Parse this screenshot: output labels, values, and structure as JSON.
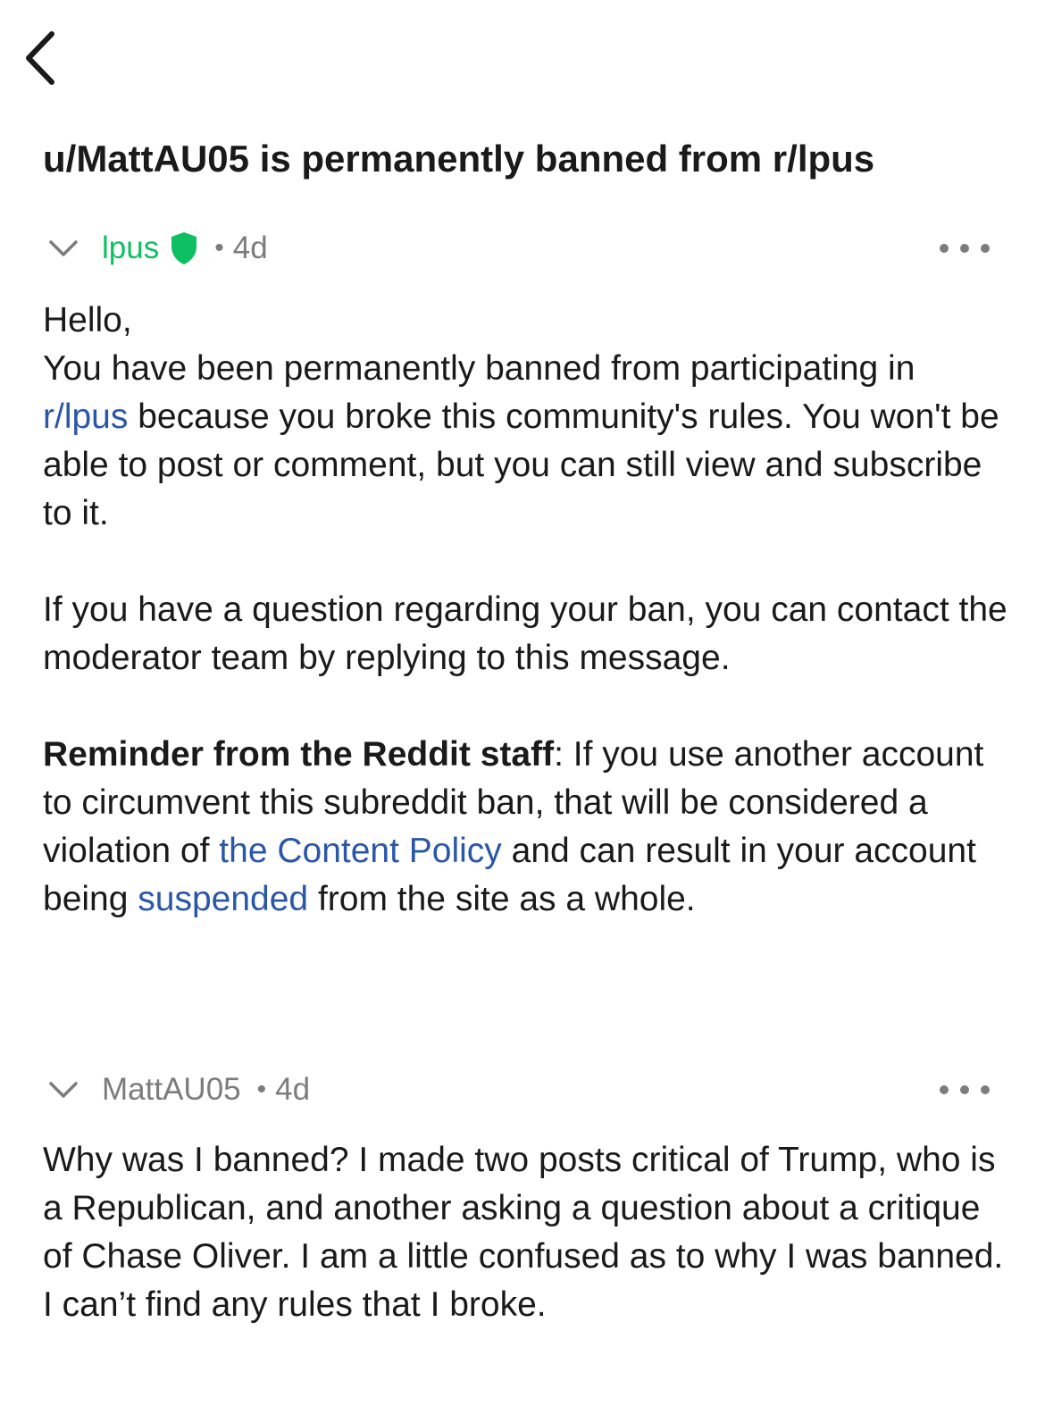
{
  "header": {
    "back_icon": "chevron-left-icon",
    "title": "u/MattAU05 is permanently banned from r/lpus"
  },
  "colors": {
    "moderator_green": "#0fbf64",
    "link_blue": "#2a57a8",
    "meta_gray": "#7c7c7c",
    "text": "#1a1a1b"
  },
  "messages": [
    {
      "author": "lpus",
      "author_icon": "moderator-shield-icon",
      "separator": "•",
      "time": "4d",
      "collapse_icon": "chevron-down-icon",
      "more_icon": "more-horizontal-icon",
      "lines": {
        "l1": "Hello,",
        "l2a": "You have been permanently banned from participating in ",
        "l2_link": "r/lpus",
        "l2b": " because you broke this community's rules. You won't be able to post or comment, but you can still view and subscribe to it.",
        "p2": "If you have a question regarding your ban, you can contact the moderator team by replying to this message.",
        "p3_bold": "Reminder from the Reddit staff",
        "p3a": ": If you use another account to circumvent this subreddit ban, that will be considered a violation of ",
        "p3_link1": "the Content Policy",
        "p3b": " and can result in your account being ",
        "p3_link2": "suspended",
        "p3c": " from the site as a whole."
      }
    },
    {
      "author": "MattAU05",
      "separator": "•",
      "time": "4d",
      "collapse_icon": "chevron-down-icon",
      "more_icon": "more-horizontal-icon",
      "text": "Why was I banned? I made two posts critical of Trump, who is a Republican, and another asking a question about a critique of Chase Oliver. I am a little confused as to why I was banned. I can’t find any rules that I broke."
    }
  ]
}
